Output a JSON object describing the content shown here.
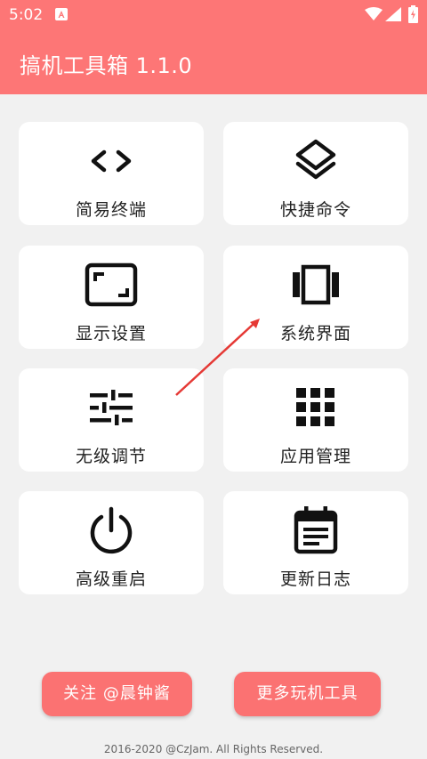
{
  "status_bar": {
    "time": "5:02",
    "icons": [
      "app-notification-icon",
      "wifi-icon",
      "signal-icon",
      "battery-charging-icon"
    ]
  },
  "app_bar": {
    "title": "搞机工具箱 1.1.0",
    "color": "#fd7676"
  },
  "menu": [
    {
      "label": "简易终端",
      "icon": "code-brackets-icon"
    },
    {
      "label": "快捷命令",
      "icon": "layers-icon"
    },
    {
      "label": "显示设置",
      "icon": "screen-corners-icon"
    },
    {
      "label": "系统界面",
      "icon": "view-carousel-icon"
    },
    {
      "label": "无级调节",
      "icon": "sliders-icon"
    },
    {
      "label": "应用管理",
      "icon": "apps-grid-icon"
    },
    {
      "label": "高级重启",
      "icon": "power-icon"
    },
    {
      "label": "更新日志",
      "icon": "calendar-note-icon"
    }
  ],
  "buttons": {
    "follow": "关注 @晨钟酱",
    "more_tools": "更多玩机工具"
  },
  "footer": "2016-2020 @CzJam. All Rights Reserved.",
  "accent_color": "#fb7272",
  "annotation_arrow_color": "#e53935"
}
